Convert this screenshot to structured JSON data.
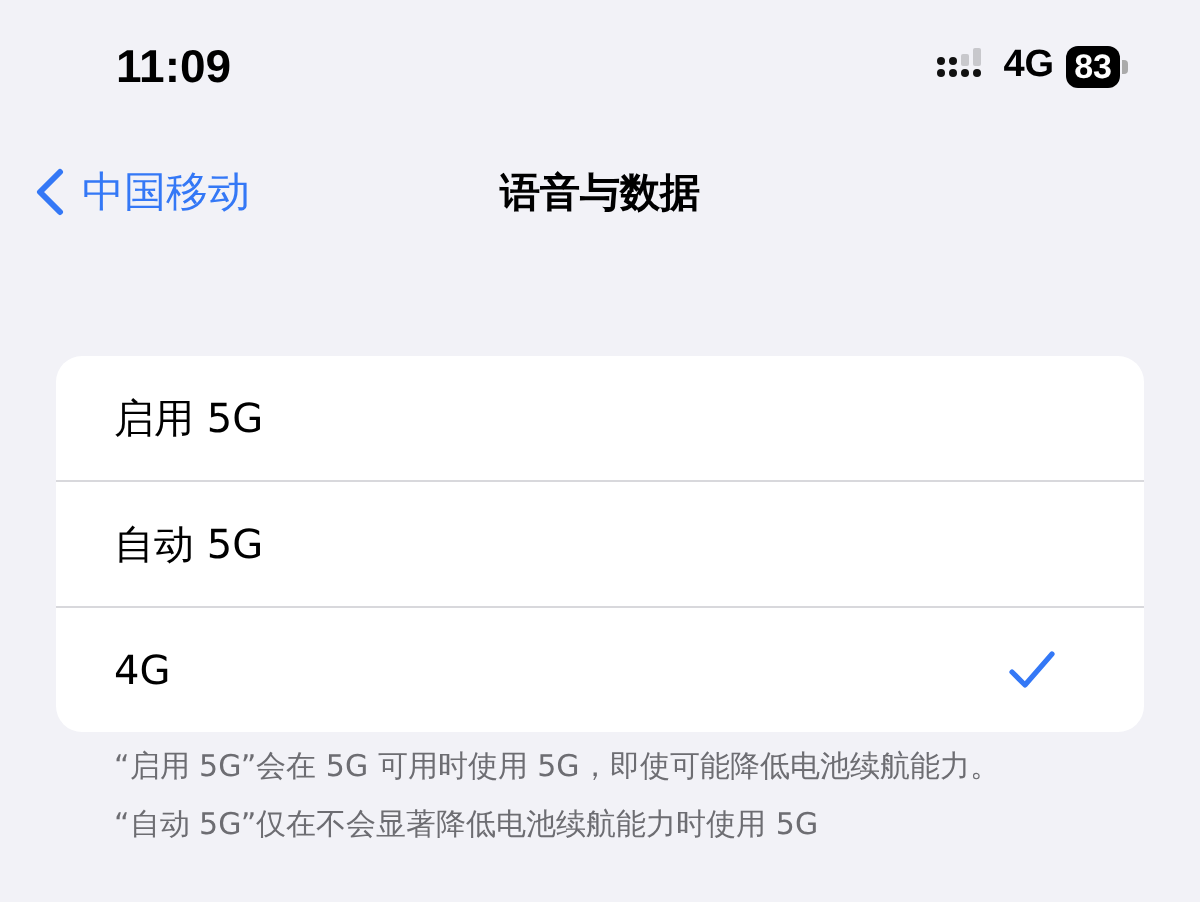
{
  "status_bar": {
    "time": "11:09",
    "network": "4G",
    "battery": "83"
  },
  "nav": {
    "back_label": "中国移动",
    "title": "语音与数据"
  },
  "options": [
    {
      "label": "启用 5G",
      "selected": false
    },
    {
      "label": "自动 5G",
      "selected": false
    },
    {
      "label": "4G",
      "selected": true
    }
  ],
  "footnotes": [
    "“启用 5G”会在 5G 可用时使用 5G，即使可能降低电池续航能力。",
    "“自动 5G”仅在不会显著降低电池续航能力时使用 5G"
  ]
}
